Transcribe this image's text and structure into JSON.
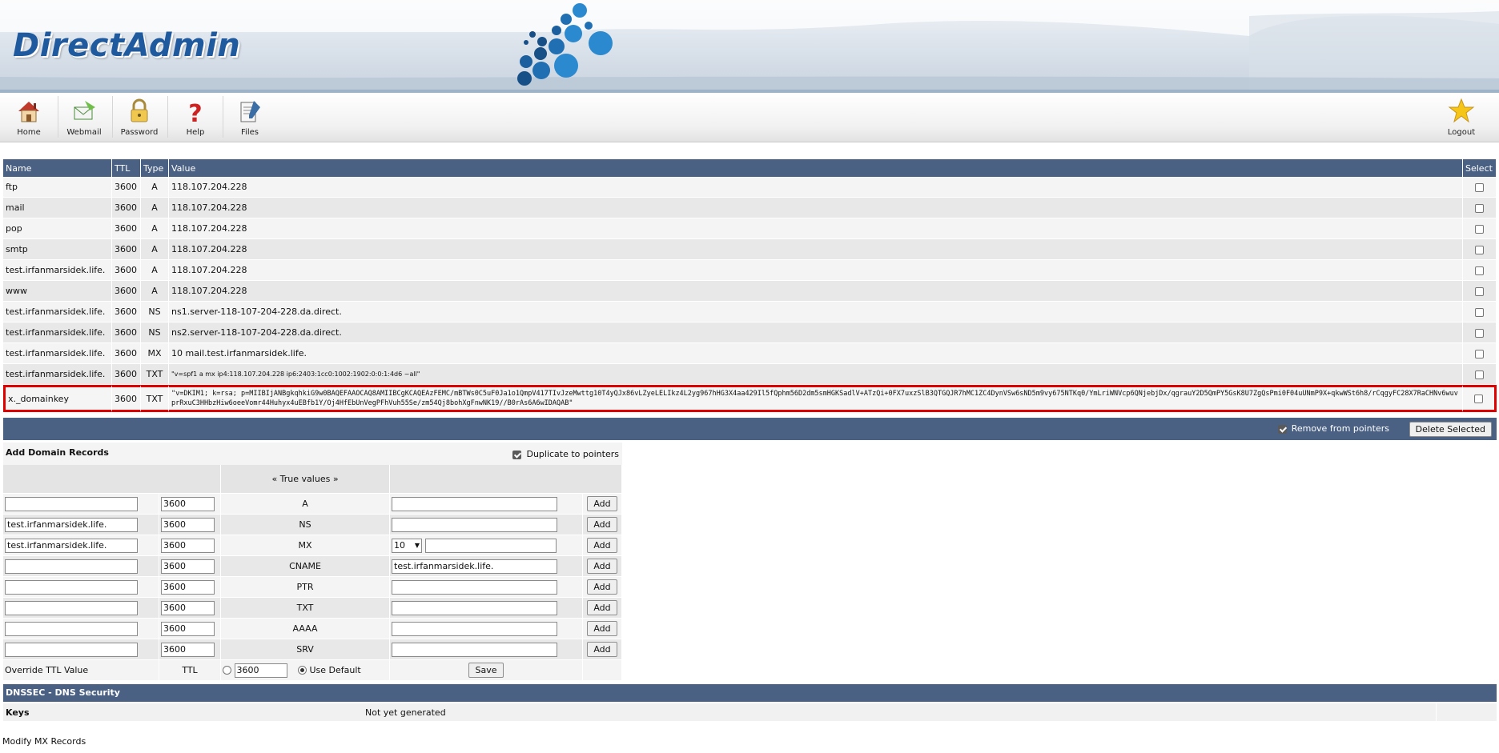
{
  "brand": {
    "logo_text": "DirectAdmin"
  },
  "toolbar": {
    "home": "Home",
    "webmail": "Webmail",
    "password": "Password",
    "help": "Help",
    "files": "Files",
    "logout": "Logout"
  },
  "records": {
    "headers": {
      "name": "Name",
      "ttl": "TTL",
      "type": "Type",
      "value": "Value",
      "select": "Select"
    },
    "rows": [
      {
        "name": "ftp",
        "ttl": "3600",
        "type": "A",
        "value": "118.107.204.228"
      },
      {
        "name": "mail",
        "ttl": "3600",
        "type": "A",
        "value": "118.107.204.228"
      },
      {
        "name": "pop",
        "ttl": "3600",
        "type": "A",
        "value": "118.107.204.228"
      },
      {
        "name": "smtp",
        "ttl": "3600",
        "type": "A",
        "value": "118.107.204.228"
      },
      {
        "name": "test.irfanmarsidek.life.",
        "ttl": "3600",
        "type": "A",
        "value": "118.107.204.228"
      },
      {
        "name": "www",
        "ttl": "3600",
        "type": "A",
        "value": "118.107.204.228"
      },
      {
        "name": "test.irfanmarsidek.life.",
        "ttl": "3600",
        "type": "NS",
        "value": "ns1.server-118-107-204-228.da.direct."
      },
      {
        "name": "test.irfanmarsidek.life.",
        "ttl": "3600",
        "type": "NS",
        "value": "ns2.server-118-107-204-228.da.direct."
      },
      {
        "name": "test.irfanmarsidek.life.",
        "ttl": "3600",
        "type": "MX",
        "value": "10 mail.test.irfanmarsidek.life."
      },
      {
        "name": "test.irfanmarsidek.life.",
        "ttl": "3600",
        "type": "TXT",
        "value": "\"v=spf1 a mx ip4:118.107.204.228 ip6:2403:1cc0:1002:1902:0:0:1:4d6 ~all\""
      },
      {
        "name": "x._domainkey",
        "ttl": "3600",
        "type": "TXT",
        "value": "\"v=DKIM1; k=rsa; p=MIIBIjANBgkqhkiG9w0BAQEFAAOCAQ8AMIIBCgKCAQEAzFEMC/mBTWs0C5uF0Ja1o1QmpV417TIvJzeMwttg10T4yQJx86vLZyeLELIkz4L2yg967hHG3X4aa429Il5fQphm56D2dm5smHGKSadlV+ATzQi+0FX7uxzSlB3QTGQJR7hMC1ZC4DynVSw6sND5m9vy675NTKq0/YmLriWNVcp6QNjebjDx/qgrauY2D5QmPY5GsK8U7ZgQsPmi0F04uUNmP9X+qkwWSt6h8/rCqgyFC28X7RaCHNv6wuvprRxuC3HHbzHiw6oeeVomr44Huhyx4uEBfb1Y/Oj4HfEbUnVegPFhVuh55Se/zm54Qj8bohXgFnwNK19//B0rAs6A6wIDAQAB\""
      }
    ],
    "remove_from_pointers": "Remove from pointers",
    "delete_selected": "Delete Selected"
  },
  "add_records": {
    "title": "Add Domain Records",
    "duplicate_to_pointers": "Duplicate to pointers",
    "true_values": "« True values »",
    "rows": [
      {
        "name": "",
        "ttl": "3600",
        "type": "A",
        "value": "",
        "add": "Add"
      },
      {
        "name": "test.irfanmarsidek.life.",
        "ttl": "3600",
        "type": "NS",
        "value": "",
        "add": "Add"
      },
      {
        "name": "test.irfanmarsidek.life.",
        "ttl": "3600",
        "type": "MX",
        "priority": "10",
        "value": "",
        "add": "Add"
      },
      {
        "name": "",
        "ttl": "3600",
        "type": "CNAME",
        "value": "test.irfanmarsidek.life.",
        "add": "Add"
      },
      {
        "name": "",
        "ttl": "3600",
        "type": "PTR",
        "value": "",
        "add": "Add"
      },
      {
        "name": "",
        "ttl": "3600",
        "type": "TXT",
        "value": "",
        "add": "Add"
      },
      {
        "name": "",
        "ttl": "3600",
        "type": "AAAA",
        "value": "",
        "add": "Add"
      },
      {
        "name": "",
        "ttl": "3600",
        "type": "SRV",
        "value": "",
        "add": "Add"
      }
    ],
    "override_label": "Override TTL Value",
    "ttl_label": "TTL",
    "override_ttl_value": "3600",
    "use_default": "Use Default",
    "save": "Save"
  },
  "dnssec": {
    "title": "DNSSEC - DNS Security",
    "keys_label": "Keys",
    "keys_value": "Not yet generated"
  },
  "footer": {
    "modify_mx": "Modify MX Records"
  },
  "colors": {
    "header_bar": "#4a6184",
    "highlight": "#e00000",
    "logo": "#1f5a9e"
  }
}
